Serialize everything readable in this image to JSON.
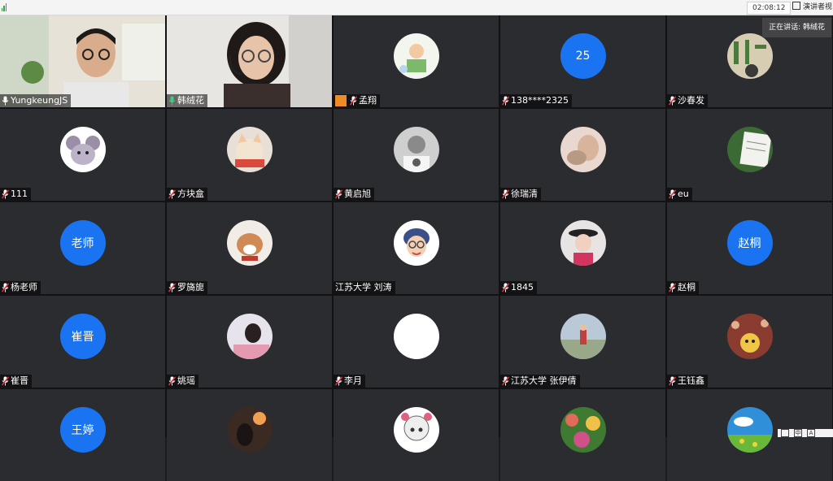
{
  "top_bar": {
    "timer": "02:08:12",
    "speaker_view_label": "演讲者视"
  },
  "speaking_indicator": "正在讲话: 韩绒花",
  "tray": [
    "中",
    "A"
  ],
  "participants": [
    {
      "name": "YungkeungJS",
      "kind": "video",
      "mic": "on"
    },
    {
      "name": "韩绒花",
      "kind": "video",
      "mic": "on-green",
      "active": true
    },
    {
      "name": "孟翔",
      "kind": "photo",
      "mic": "muted",
      "host": true,
      "photo": "kid-drawing"
    },
    {
      "name": "138****2325",
      "kind": "initials",
      "initials": "25",
      "mic": "muted"
    },
    {
      "name": "沙春发",
      "kind": "photo",
      "mic": "muted",
      "photo": "calligraphy"
    },
    {
      "name": "111",
      "kind": "photo",
      "mic": "muted",
      "photo": "mouse-cartoon"
    },
    {
      "name": "方块盒",
      "kind": "photo",
      "mic": "muted",
      "photo": "cat"
    },
    {
      "name": "黄启旭",
      "kind": "photo",
      "mic": "muted",
      "photo": "bw-portrait"
    },
    {
      "name": "徐瑞清",
      "kind": "photo",
      "mic": "muted",
      "photo": "girl-with-cat"
    },
    {
      "name": "eu",
      "kind": "photo",
      "mic": "muted",
      "photo": "notebook"
    },
    {
      "name": "杨老师",
      "kind": "initials",
      "initials": "老师",
      "mic": "muted"
    },
    {
      "name": "罗旖旎",
      "kind": "photo",
      "mic": "muted",
      "photo": "fox-plush"
    },
    {
      "name": "江苏大学 刘涛",
      "kind": "photo",
      "mic": "none",
      "photo": "memoji-girl"
    },
    {
      "name": "1845",
      "kind": "photo",
      "mic": "muted",
      "photo": "girl-hat"
    },
    {
      "name": "赵桐",
      "kind": "initials",
      "initials": "赵桐",
      "mic": "muted"
    },
    {
      "name": "崔晋",
      "kind": "initials",
      "initials": "崔晋",
      "mic": "muted"
    },
    {
      "name": "姚瑶",
      "kind": "photo",
      "mic": "muted",
      "photo": "girl-pink"
    },
    {
      "name": "李月",
      "kind": "blank",
      "mic": "muted"
    },
    {
      "name": "江苏大学  张伊倩",
      "kind": "photo",
      "mic": "muted",
      "photo": "girl-road"
    },
    {
      "name": "王钰鑫",
      "kind": "photo",
      "mic": "muted",
      "photo": "dog-crowd"
    },
    {
      "name": "",
      "kind": "initials",
      "initials": "王婷",
      "mic": "none"
    },
    {
      "name": "",
      "kind": "photo",
      "mic": "none",
      "photo": "sunset-portrait"
    },
    {
      "name": "",
      "kind": "photo",
      "mic": "none",
      "photo": "anime-girl"
    },
    {
      "name": "",
      "kind": "photo",
      "mic": "none",
      "photo": "flower-garden"
    },
    {
      "name": "",
      "kind": "photo",
      "mic": "none",
      "photo": "sky-field"
    }
  ],
  "colors": {
    "tile_bg": "#2b2c30",
    "initials_blue": "#1a74f1",
    "active_green": "#3ad07a",
    "host_orange": "#f08a24",
    "muted_red": "#d6333a"
  }
}
